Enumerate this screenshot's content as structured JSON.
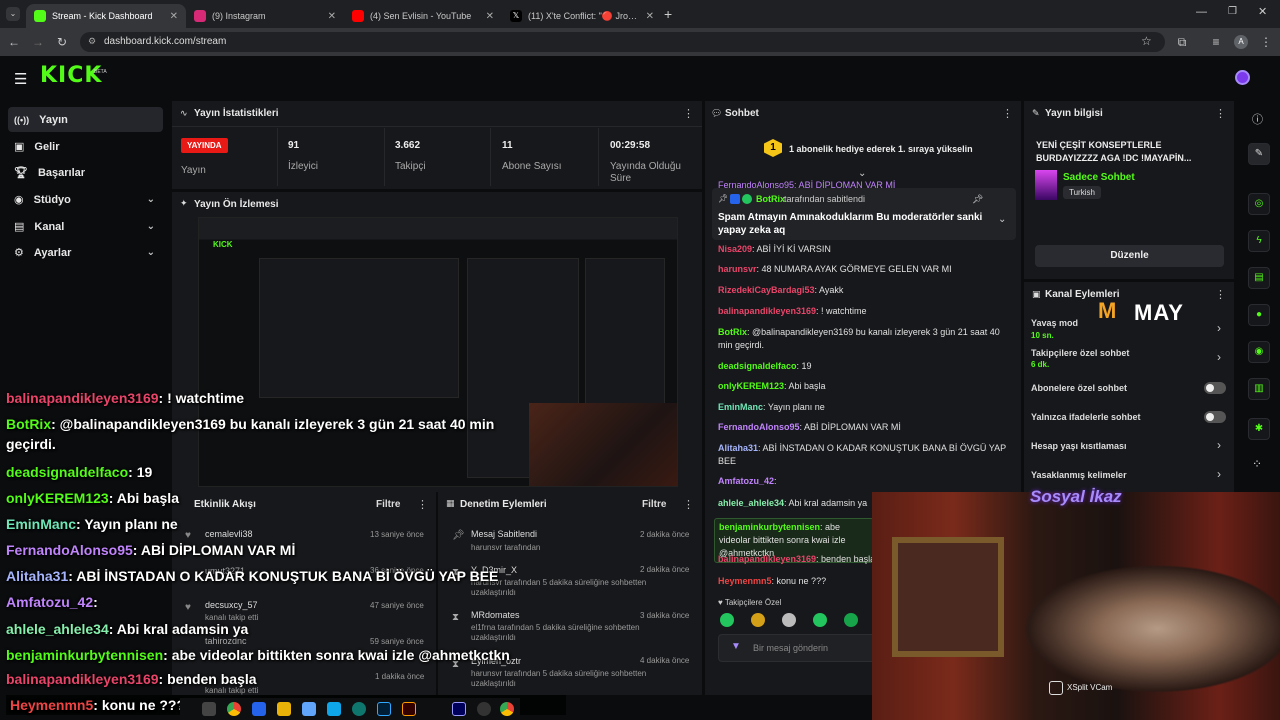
{
  "browser": {
    "tabs": [
      {
        "label": "Stream - Kick Dashboard",
        "color": "#53fc18"
      },
      {
        "label": "(9) Instagram",
        "color": "#d62976"
      },
      {
        "label": "(4) Sen Evlisin - YouTube",
        "color": "#ff0000"
      },
      {
        "label": "(11) X'te Conflict: \"🔴 Jrokez la...",
        "color": "#ffffff"
      }
    ],
    "url": "dashboard.kick.com/stream"
  },
  "brand": {
    "logo": "KICK",
    "beta": "BETA",
    "accent": "#53fc18"
  },
  "sidebar": {
    "items": [
      {
        "label": "Yayın",
        "icon": "broadcast-icon"
      },
      {
        "label": "Gelir",
        "icon": "money-icon"
      },
      {
        "label": "Başarılar",
        "icon": "trophy-icon"
      },
      {
        "label": "Stüdyo",
        "icon": "studio-icon"
      },
      {
        "label": "Kanal",
        "icon": "channel-icon"
      },
      {
        "label": "Ayarlar",
        "icon": "gear-icon"
      }
    ]
  },
  "stats": {
    "title": "Yayın İstatistikleri",
    "live_badge": "YAYINDA",
    "live_label": "Yayın",
    "viewers": "91",
    "viewers_label": "İzleyici",
    "followers": "3.662",
    "followers_label": "Takipçi",
    "subs": "11",
    "subs_label": "Abone Sayısı",
    "uptime": "00:29:58",
    "uptime_label": "Yayında Olduğu Süre"
  },
  "preview": {
    "title": "Yayın Ön İzlemesi"
  },
  "overlay_chat": [
    {
      "user": "balinapandikleyen3169",
      "color": "#e9456a",
      "text": ": ! watchtime"
    },
    {
      "user": "BotRix",
      "color": "#53fc18",
      "text": ": @balinapandikleyen3169 bu kanalı izleyerek 3 gün 21 saat 40 min geçirdi."
    },
    {
      "user": "deadsignaldelfaco",
      "color": "#53fc18",
      "text": ": 19"
    },
    {
      "user": "onlyKEREM123",
      "color": "#53fc18",
      "text": ": Abi başla"
    },
    {
      "user": "EminManc",
      "color": "#6ee7b7",
      "text": ": Yayın planı ne"
    },
    {
      "user": "FernandoAlonso95",
      "color": "#c084fc",
      "text": ": ABİ DİPLOMAN VAR Mİ"
    },
    {
      "user": "Alitaha31",
      "color": "#a5b4fc",
      "text": ": ABİ İNSTADAN O KADAR KONUŞTUK BANA Bİ ÖVGÜ YAP BEE"
    },
    {
      "user": "Amfatozu_42",
      "color": "#c084fc",
      "text": ":"
    },
    {
      "user": "ahlele_ahlele34",
      "color": "#86efac",
      "text": ": Abi kral adamsin ya"
    },
    {
      "user": "benjaminkurbytennisen",
      "color": "#53fc18",
      "text": ": abe videolar bittikten sonra kwai izle @ahmetkctkn"
    },
    {
      "user": "balinapandikleyen3169",
      "color": "#e9456a",
      "text": ": benden başla"
    },
    {
      "user": "Heymenmn5",
      "color": "#ef4444",
      "text": ": konu ne ???"
    }
  ],
  "activity": {
    "title": "Etkinlik Akışı",
    "filter": "Filtre",
    "events": [
      {
        "user": "cemalevli38",
        "time": "13 saniye önce"
      },
      {
        "user": "umut3271",
        "time": "36 saniye önce"
      },
      {
        "user": "decsuxcy_57",
        "sub": "kanalı takip etti",
        "time": "47 saniye önce"
      },
      {
        "user": "tahirozdnc",
        "time": "59 saniye önce"
      },
      {
        "user": "kanalı takip etti",
        "time": "1 dakika önce"
      }
    ]
  },
  "moderation": {
    "title": "Denetim Eylemleri",
    "filter": "Filtre",
    "events": [
      {
        "action": "Mesaj Sabitlendi",
        "sub": "harunsvr tarafından",
        "time": "2 dakika önce"
      },
      {
        "action": "Y_D3mir_X",
        "sub": "harunsvr tarafından 5 dakika süreliğine sohbetten uzaklaştırıldı",
        "time": "2 dakika önce"
      },
      {
        "action": "MRdomates",
        "sub": "el1frna tarafından 5 dakika süreliğine sohbetten uzaklaştırıldı",
        "time": "3 dakika önce"
      },
      {
        "action": "Eylmen_oztr",
        "sub": "harunsvr tarafından 5 dakika süreliğine sohbetten uzaklaştırıldı",
        "time": "4 dakika önce"
      }
    ]
  },
  "chat": {
    "title": "Sohbet",
    "gift_banner": "1 abonelik hediye ederek 1. sıraya yükselin",
    "gift_rank": "1",
    "pinned_top_line": "FernandoAlonso95: ABİ DİPLOMAN VAR Mİ",
    "pinned_by": "BotRix",
    "pinned_by_suffix": "tarafından sabitlendi",
    "pinned_text": "Spam Atmayın Amınakoduklarım Bu moderatörler sanki yapay zeka aq",
    "messages": [
      {
        "user": "Nisa209",
        "color": "#e9456a",
        "text": ": ABİ İYİ Kİ VARSIN"
      },
      {
        "user": "harunsvr",
        "color": "#e9456a",
        "text": ": 48 NUMARA AYAK GÖRMEYE GELEN VAR MI"
      },
      {
        "user": "RizedekiCayBardagi53",
        "color": "#e9456a",
        "text": ": Ayakk"
      },
      {
        "user": "balinapandikleyen3169",
        "color": "#e9456a",
        "text": ": ! watchtime"
      },
      {
        "user": "BotRix",
        "color": "#53fc18",
        "text": ": @balinapandikleyen3169 bu kanalı izleyerek 3 gün 21 saat 40 min geçirdi."
      },
      {
        "user": "deadsignaldelfaco",
        "color": "#53fc18",
        "text": ": 19"
      },
      {
        "user": "onlyKEREM123",
        "color": "#53fc18",
        "text": ": Abi başla"
      },
      {
        "user": "EminManc",
        "color": "#6ee7b7",
        "text": ": Yayın planı ne"
      },
      {
        "user": "FernandoAlonso95",
        "color": "#c084fc",
        "text": ": ABİ DİPLOMAN VAR Mİ"
      },
      {
        "user": "Alitaha31",
        "color": "#a5b4fc",
        "text": ": ABİ İNSTADAN O KADAR KONUŞTUK BANA Bİ ÖVGÜ YAP BEE"
      },
      {
        "user": "Amfatozu_42",
        "color": "#c084fc",
        "text": ":"
      },
      {
        "user": "ahlele_ahlele34",
        "color": "#86efac",
        "text": ": Abi kral adamsin ya"
      },
      {
        "user": "benjaminkurbytennisen",
        "color": "#53fc18",
        "text": ": abe videolar bittikten sonra kwai izle @ahmetkctkn"
      },
      {
        "user": "balinapandikleyen3169",
        "color": "#e9456a",
        "text": ": benden başla"
      },
      {
        "user": "Heymenmn5",
        "color": "#ef4444",
        "text": ": konu ne ???"
      }
    ],
    "mode_label": "Takipçilere Özel",
    "input_placeholder": "Bir mesaj gönderin"
  },
  "stream_info": {
    "title": "Yayın bilgisi",
    "stream_title": "YENİ ÇEŞİT KONSEPTLERLE BURDAYIZZZZ AGA !DC !MAYAPİN...",
    "category": "Sadece Sohbet",
    "language": "Turkish",
    "edit_button": "Düzenle"
  },
  "channel_actions": {
    "title": "Kanal Eylemleri",
    "slow_mode": "Yavaş mod",
    "slow_mode_value": "10 sn.",
    "followers_only": "Takipçilere özel sohbet",
    "followers_only_value": "6 dk.",
    "subs_only": "Abonelere özel sohbet",
    "emotes_only": "Yalnızca ifadelerle sohbet",
    "account_age": "Hesap yaşı kısıtlaması",
    "banned_words": "Yasaklanmış kelimeler"
  },
  "webcam": {
    "overlay_title": "Sosyal İkaz",
    "vcam_label": "XSplit VCam",
    "watermark": "MAY"
  }
}
